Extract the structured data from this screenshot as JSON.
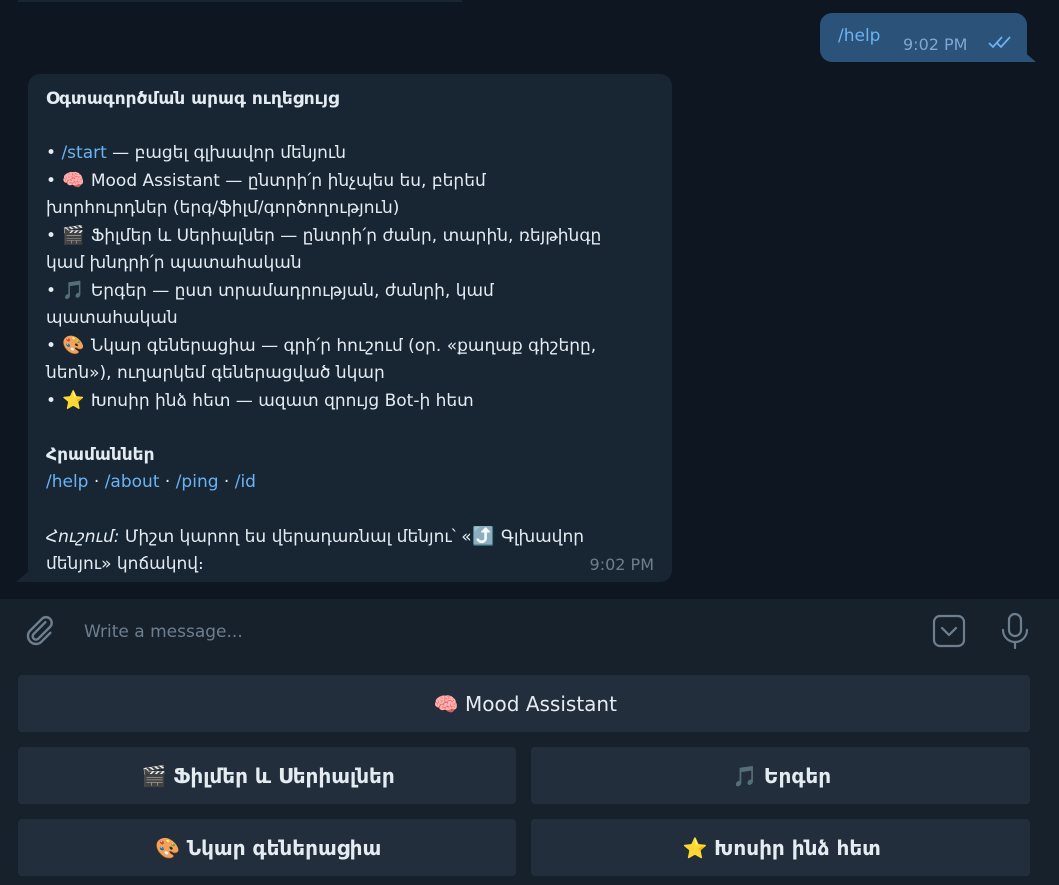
{
  "chat": {
    "outgoing": {
      "text": "/help",
      "time": "9:02 PM",
      "status": "read"
    },
    "incoming": {
      "title": "Օգտագործման արագ ուղեցույց",
      "items": [
        {
          "emoji": "",
          "cmd": "/start",
          "rest": " — բացել գլխավոր մենյուն"
        },
        {
          "emoji": "🧠",
          "cmd": "",
          "rest": "Mood Assistant — ընտրի՛ր ինչպես ես, բերեմ"
        },
        {
          "emoji": "",
          "cmd": "",
          "rest": "խորհուրդներ (երգ/ֆիլմ/գործողություն)"
        },
        {
          "emoji": "🎬",
          "cmd": "",
          "rest": "Ֆիլմեր և Սերիալներ — ընտրի՛ր ժանր, տարին, ռեյթինգը"
        },
        {
          "emoji": "",
          "cmd": "",
          "rest": "կամ խնդրի՛ր պատահական"
        },
        {
          "emoji": "🎵",
          "cmd": "",
          "rest": "Երգեր — ըստ տրամադրության, ժանրի, կամ"
        },
        {
          "emoji": "",
          "cmd": "",
          "rest": "պատահական"
        },
        {
          "emoji": "🎨",
          "cmd": "",
          "rest": "Նկար գեներացիա — գրի՛ր հուշում (օր. «քաղաք գիշերը,"
        },
        {
          "emoji": "",
          "cmd": "",
          "rest": "նեոն»), ուղարկեմ գեներացված նկար"
        },
        {
          "emoji": "⭐",
          "cmd": "",
          "rest": "Խոսիր ինձ հետ — ազատ զրույց Bot-ի հետ"
        }
      ],
      "commands_title": "Հրամաններ",
      "commands": [
        "/help",
        "/about",
        "/ping",
        "/id"
      ],
      "tip_label": "Հուշում:",
      "tip_line1": " Միշտ կարող ես վերադառնալ մենյու՝ «",
      "tip_emoji": "⤴️",
      "tip_line1_end": " Գլխավոր",
      "tip_line2": "մենյու» կոճակով։",
      "time": "9:02 PM"
    }
  },
  "composer": {
    "placeholder": "Write a message..."
  },
  "keyboard": {
    "row1": [
      {
        "emoji": "🧠",
        "label": "Mood Assistant"
      }
    ],
    "row2": [
      {
        "emoji": "🎬",
        "label": "Ֆիլմեր և Սերիալներ"
      },
      {
        "emoji": "🎵",
        "label": "Երգեր"
      }
    ],
    "row3": [
      {
        "emoji": "🎨",
        "label": "Նկար գեներացիա"
      },
      {
        "emoji": "⭐",
        "label": "Խոսիր ինձ հետ"
      }
    ]
  },
  "colors": {
    "background": "#0e1621",
    "bubble_in": "#182533",
    "bubble_out": "#2b5278",
    "link": "#6ab3f3",
    "keyboard_button": "#232e3c"
  }
}
